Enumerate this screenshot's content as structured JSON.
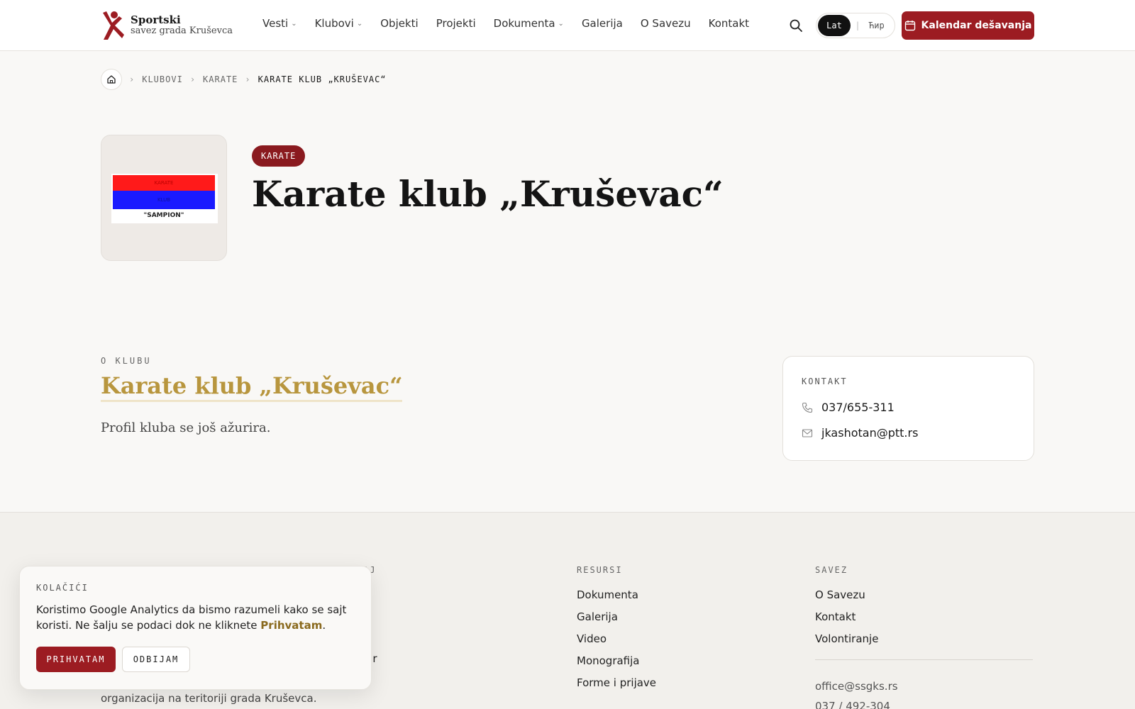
{
  "brand": {
    "name_line1": "Sportski",
    "name_line2": "savez grada Kruševca",
    "accent_color": "#9c1c22",
    "gold_color": "#b8963e"
  },
  "nav": {
    "items": [
      {
        "label": "Vesti",
        "has_dropdown": true
      },
      {
        "label": "Klubovi",
        "has_dropdown": true
      },
      {
        "label": "Objekti",
        "has_dropdown": false
      },
      {
        "label": "Projekti",
        "has_dropdown": false
      },
      {
        "label": "Dokumenta",
        "has_dropdown": true
      },
      {
        "label": "Galerija",
        "has_dropdown": false
      },
      {
        "label": "O Savezu",
        "has_dropdown": false
      },
      {
        "label": "Kontakt",
        "has_dropdown": false
      }
    ],
    "search_icon": "search-icon",
    "lang_active": "Lat",
    "lang_inactive": "Ћир",
    "calendar_button": "Kalendar dešavanja"
  },
  "breadcrumb": {
    "items": [
      "KLUBOVI",
      "KARATE",
      "KARATE KLUB „KRUŠEVAC“"
    ]
  },
  "hero": {
    "badge": "KARATE",
    "title": "Karate klub „Kruševac“",
    "logo": {
      "line1": "KARATE",
      "line2": "KLUB",
      "line3": "\"SAMPION\""
    }
  },
  "about": {
    "label": "O KLUBU",
    "title": "Karate klub „Kruševac“",
    "description": "Profil kluba se još ažurira."
  },
  "contact": {
    "label": "KONTAKT",
    "phone": "037/655-311",
    "email": "jkashotan@ptt.rs"
  },
  "footer": {
    "col2_head_partial": "AJ",
    "col2_items_partial": [
      "i",
      "i",
      "lar"
    ],
    "about_partial": "organizacija na teritoriji grada Kruševca.",
    "resources": {
      "head": "RESURSI",
      "items": [
        "Dokumenta",
        "Galerija",
        "Video",
        "Monografija",
        "Forme i prijave"
      ]
    },
    "savez": {
      "head": "SAVEZ",
      "items": [
        "O Savezu",
        "Kontakt",
        "Volontiranje"
      ],
      "email": "office@ssgks.rs",
      "phone": "037 / 492-304"
    }
  },
  "cookie": {
    "title": "KOLAČIĆI",
    "text_before": "Koristimo Google Analytics da bismo razumeli kako se sajt koristi. Ne šalju se podaci dok ne kliknete ",
    "text_accent": "Prihvatam",
    "text_after": ".",
    "accept": "PRIHVATAM",
    "reject": "ODBIJAM"
  }
}
